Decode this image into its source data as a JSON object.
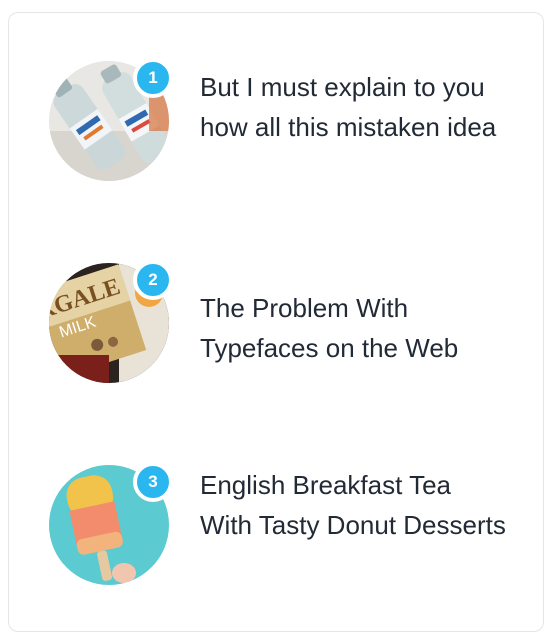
{
  "posts": [
    {
      "rank": "1",
      "title": "But I must explain to you how all this mistaken idea",
      "thumbnail": "water-bottles-image"
    },
    {
      "rank": "2",
      "title": "The Problem With Typefaces on the Web",
      "thumbnail": "milk-chocolate-box-image",
      "thumbnail_text": "RGALE MILK"
    },
    {
      "rank": "3",
      "title": "English Breakfast Tea With Tasty Donut Desserts",
      "thumbnail": "popsicle-image"
    }
  ],
  "colors": {
    "badge": "#2ab7f0",
    "title": "#222a36",
    "card_border": "#e4e6ea"
  }
}
